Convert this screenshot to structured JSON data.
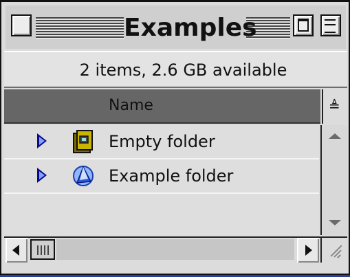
{
  "window": {
    "title": "Examples",
    "info_text": "2 items, 2.6 GB available",
    "column_header": "Name",
    "sort_indicator": "≜"
  },
  "items": [
    {
      "label": "Empty folder",
      "icon": "folder-icon"
    },
    {
      "label": "Example folder",
      "icon": "globe-folder-icon"
    }
  ],
  "icons": {
    "close": "close-box-icon",
    "zoom": "zoom-box-icon",
    "collapse": "windowshade-box-icon",
    "resize": "grow-box-icon"
  },
  "colors": {
    "window_bg": "#dcdcdc",
    "column_header_bg": "#666666",
    "disclosure_triangle": "#0a0a8a",
    "desktop": "#3a4fa8"
  }
}
